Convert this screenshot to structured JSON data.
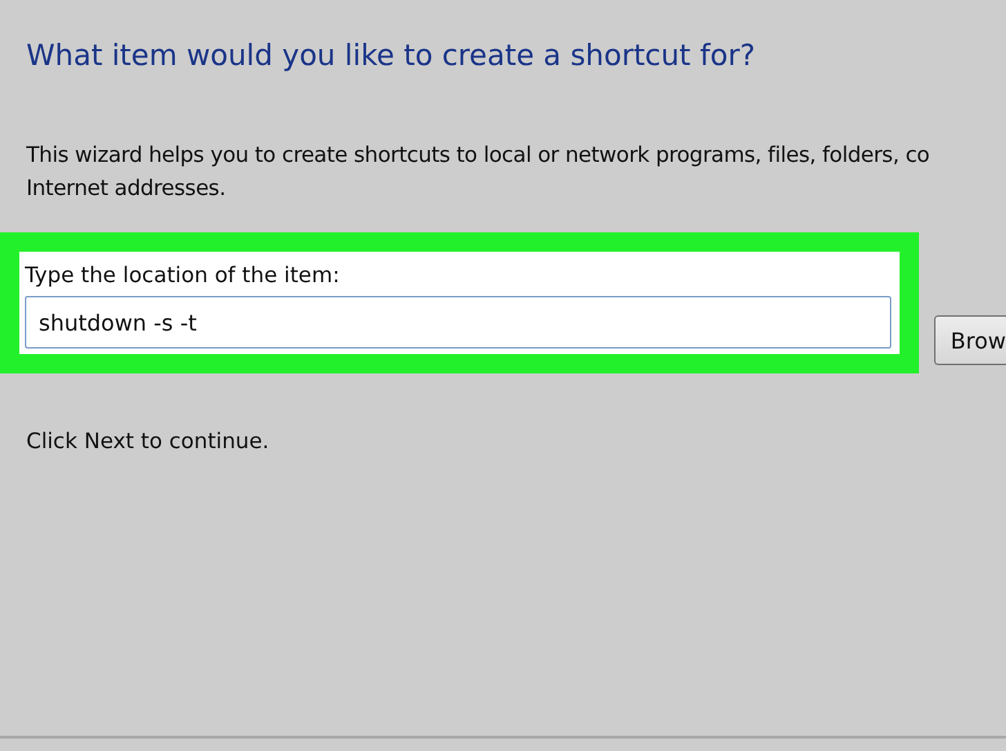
{
  "heading": "What item would you like to create a shortcut for?",
  "description": [
    "This wizard helps you to create shortcuts to local or network programs, files, folders, co",
    "Internet addresses."
  ],
  "location": {
    "label": "Type the location of the item:",
    "value": "shutdown -s -t",
    "highlighted": true
  },
  "browse_button": "Brow",
  "footer_text": "Click Next to continue."
}
